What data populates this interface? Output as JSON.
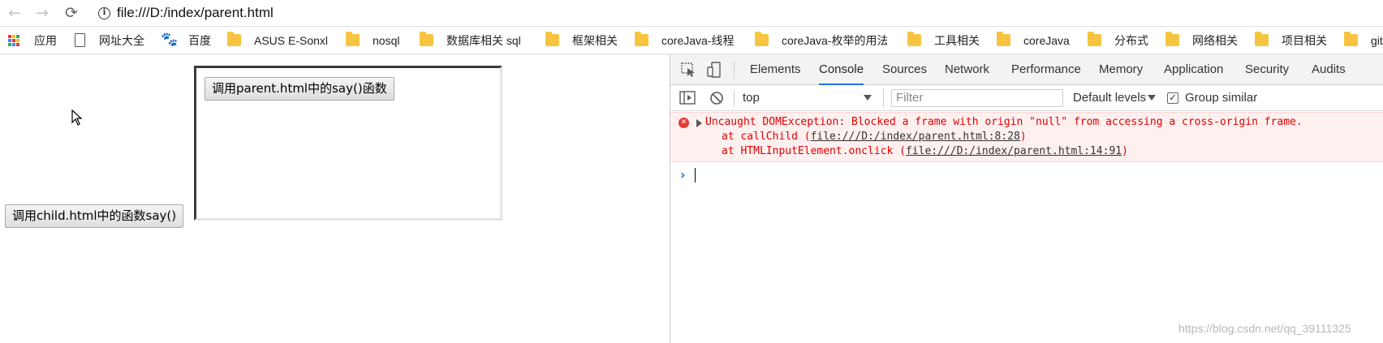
{
  "address_bar": {
    "url": "file:///D:/index/parent.html"
  },
  "bookmarks": [
    {
      "label": "应用",
      "icon": "apps-icon"
    },
    {
      "label": "网址大全",
      "icon": "page-icon"
    },
    {
      "label": "百度",
      "icon": "baidu-paw-icon"
    },
    {
      "label": "ASUS E-Sonxl",
      "icon": "folder-icon"
    },
    {
      "label": "nosql",
      "icon": "folder-icon"
    },
    {
      "label": "数据库相关 sql",
      "icon": "folder-icon"
    },
    {
      "label": "框架相关",
      "icon": "folder-icon"
    },
    {
      "label": "coreJava-线程",
      "icon": "folder-icon"
    },
    {
      "label": "coreJava-枚举的用法",
      "icon": "folder-icon"
    },
    {
      "label": "工具相关",
      "icon": "folder-icon"
    },
    {
      "label": "coreJava",
      "icon": "folder-icon"
    },
    {
      "label": "分布式",
      "icon": "folder-icon"
    },
    {
      "label": "网络相关",
      "icon": "folder-icon"
    },
    {
      "label": "项目相关",
      "icon": "folder-icon"
    },
    {
      "label": "git",
      "icon": "folder-icon"
    }
  ],
  "page": {
    "parent_button": "调用child.html中的函数say()",
    "child_button": "调用parent.html中的say()函数"
  },
  "devtools": {
    "tabs": [
      "Elements",
      "Console",
      "Sources",
      "Network",
      "Performance",
      "Memory",
      "Application",
      "Security",
      "Audits"
    ],
    "active_tab": "Console",
    "context": "top",
    "filter_placeholder": "Filter",
    "levels": "Default levels",
    "group_similar": "Group similar",
    "group_similar_checked": true,
    "error": {
      "message": "Uncaught DOMException: Blocked a frame with origin \"null\" from accessing a cross-origin frame.",
      "stack": [
        {
          "prefix": "at callChild (",
          "link": "file:///D:/index/parent.html:8:28",
          "suffix": ")"
        },
        {
          "prefix": "at HTMLInputElement.onclick (",
          "link": "file:///D:/index/parent.html:14:91",
          "suffix": ")"
        }
      ]
    }
  },
  "watermark": "https://blog.csdn.net/qq_39111325",
  "colors": {
    "accent": "#1a73e8",
    "error_text": "#e00000",
    "error_bg": "#fff0f0",
    "folder": "#f7c441"
  }
}
